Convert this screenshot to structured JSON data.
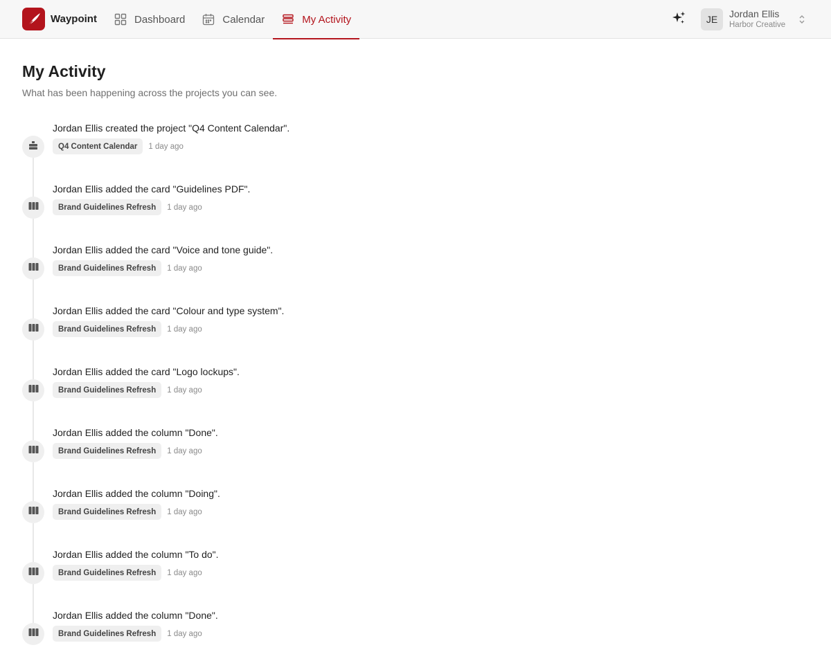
{
  "brand": {
    "name": "Waypoint",
    "color": "#b3141c"
  },
  "nav": [
    {
      "label": "Dashboard",
      "icon": "grid-icon",
      "active": false
    },
    {
      "label": "Calendar",
      "icon": "calendar-icon",
      "active": false
    },
    {
      "label": "My Activity",
      "icon": "activity-stack-icon",
      "active": true
    }
  ],
  "account": {
    "initials": "JE",
    "name": "Jordan Ellis",
    "org": "Harbor Creative"
  },
  "page": {
    "title": "My Activity",
    "subtitle": "What has been happening across the projects you can see."
  },
  "events": [
    {
      "icon": "project-icon",
      "message": "Jordan Ellis created the project \"Q4 Content Calendar\".",
      "project": "Q4 Content Calendar",
      "time": "1 day ago"
    },
    {
      "icon": "board-columns-icon",
      "message": "Jordan Ellis added the card \"Guidelines PDF\".",
      "project": "Brand Guidelines Refresh",
      "time": "1 day ago"
    },
    {
      "icon": "board-columns-icon",
      "message": "Jordan Ellis added the card \"Voice and tone guide\".",
      "project": "Brand Guidelines Refresh",
      "time": "1 day ago"
    },
    {
      "icon": "board-columns-icon",
      "message": "Jordan Ellis added the card \"Colour and type system\".",
      "project": "Brand Guidelines Refresh",
      "time": "1 day ago"
    },
    {
      "icon": "board-columns-icon",
      "message": "Jordan Ellis added the card \"Logo lockups\".",
      "project": "Brand Guidelines Refresh",
      "time": "1 day ago"
    },
    {
      "icon": "board-columns-icon",
      "message": "Jordan Ellis added the column \"Done\".",
      "project": "Brand Guidelines Refresh",
      "time": "1 day ago"
    },
    {
      "icon": "board-columns-icon",
      "message": "Jordan Ellis added the column \"Doing\".",
      "project": "Brand Guidelines Refresh",
      "time": "1 day ago"
    },
    {
      "icon": "board-columns-icon",
      "message": "Jordan Ellis added the column \"To do\".",
      "project": "Brand Guidelines Refresh",
      "time": "1 day ago"
    },
    {
      "icon": "board-columns-icon",
      "message": "Jordan Ellis added the column \"Done\".",
      "project": "Brand Guidelines Refresh",
      "time": "1 day ago"
    }
  ]
}
